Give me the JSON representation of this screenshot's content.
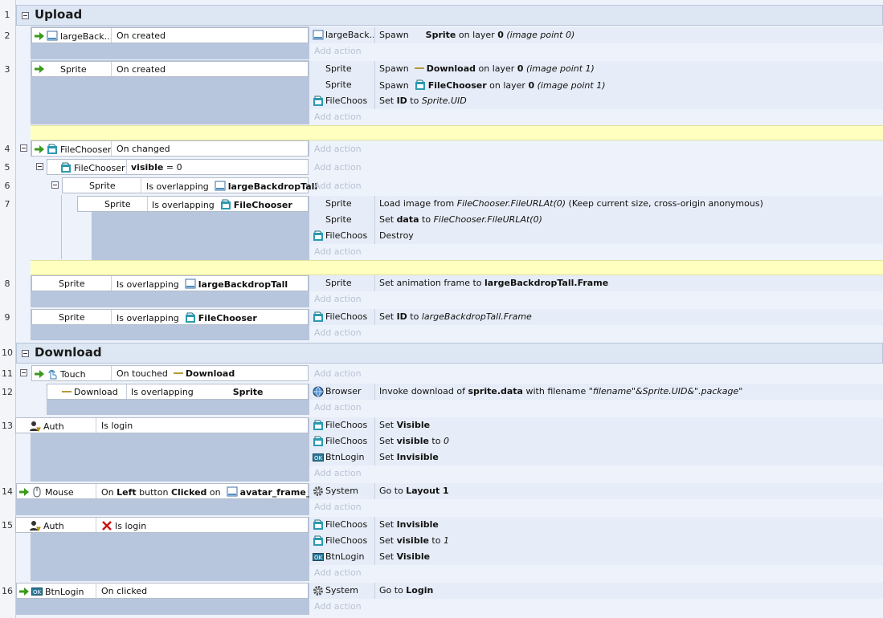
{
  "groups": {
    "upload": {
      "title": "Upload",
      "line": "1"
    },
    "download": {
      "title": "Download",
      "line": "10"
    }
  },
  "common": {
    "add_action": "Add action"
  },
  "events": {
    "e2": {
      "line": "2",
      "obj": "largeBack...",
      "cond": "On created",
      "a1": {
        "obj": "largeBack...",
        "verb": "Spawn",
        "b1": "Sprite",
        "t1": " on layer ",
        "b2": "0",
        "i1": " (image point 0)"
      }
    },
    "e3": {
      "line": "3",
      "obj": "Sprite",
      "cond": "On created",
      "a1": {
        "obj": "Sprite",
        "verb": "Spawn",
        "b1": "Download",
        "t1": " on layer ",
        "b2": "0",
        "i1": " (image point 1)"
      },
      "a2": {
        "obj": "Sprite",
        "verb": "Spawn",
        "b1": "FileChooser",
        "t1": " on layer ",
        "b2": "0",
        "i1": " (image point 1)"
      },
      "a3": {
        "obj": "FileChoos",
        "t1": "Set ",
        "b1": "ID",
        "t2": " to ",
        "i1": "Sprite.UID"
      }
    },
    "e4": {
      "line": "4",
      "obj": "FileChooser",
      "cond": "On changed"
    },
    "e5": {
      "line": "5",
      "obj": "FileChooser",
      "cond_b": "visible",
      "cond_t": " = 0"
    },
    "e6": {
      "line": "6",
      "obj": "Sprite",
      "cond": "Is overlapping",
      "target": "largeBackdropTall"
    },
    "e7": {
      "line": "7",
      "obj": "Sprite",
      "cond": "Is overlapping",
      "target": "FileChooser",
      "a1": {
        "obj": "Sprite",
        "t1": "Load image from ",
        "i1": "FileChooser.FileURLAt(0)",
        "t2": "  (Keep current size, cross-origin anonymous)"
      },
      "a2": {
        "obj": "Sprite",
        "t1": "Set ",
        "b1": "data",
        "t2": " to ",
        "i1": "FileChooser.FileURLAt(0)"
      },
      "a3": {
        "obj": "FileChoos",
        "t1": "Destroy"
      }
    },
    "e8": {
      "line": "8",
      "obj": "Sprite",
      "cond": "Is overlapping",
      "target": "largeBackdropTall",
      "a1": {
        "obj": "Sprite",
        "t1": "Set animation frame to ",
        "b1": "largeBackdropTall.Frame"
      }
    },
    "e9": {
      "line": "9",
      "obj": "Sprite",
      "cond": "Is overlapping",
      "target": "FileChooser",
      "a1": {
        "obj": "FileChoos",
        "t1": "Set ",
        "b1": "ID",
        "t2": " to ",
        "i1": "largeBackdropTall.Frame"
      }
    },
    "e11": {
      "line": "11",
      "obj": "Touch",
      "cond": "On touched",
      "target": "Download"
    },
    "e12": {
      "line": "12",
      "obj": "Download",
      "cond": "Is overlapping",
      "target": "Sprite",
      "a1": {
        "obj": "Browser",
        "t1": "Invoke download of ",
        "b1": "sprite.data",
        "t2": " with filename ",
        "i1": "\"filename\"&Sprite.UID&\".package\""
      }
    },
    "e13": {
      "line": "13",
      "obj": "Auth",
      "cond": "Is login",
      "a1": {
        "obj": "FileChoos",
        "t1": "Set ",
        "b1": "Visible"
      },
      "a2": {
        "obj": "FileChoos",
        "t1": "Set ",
        "b1": "visible",
        "t2": " to ",
        "i1": "0"
      },
      "a3": {
        "obj": "BtnLogin",
        "t1": "Set ",
        "b1": "Invisible"
      }
    },
    "e14": {
      "line": "14",
      "obj": "Mouse",
      "c1": "On ",
      "cb1": "Left",
      "c2": " button ",
      "cb2": "Clicked",
      "c3": " on ",
      "target": "avatar_frame_sm",
      "a1": {
        "obj": "System",
        "t1": "Go to ",
        "b1": "Layout 1"
      }
    },
    "e15": {
      "line": "15",
      "obj": "Auth",
      "cond": "Is login",
      "a1": {
        "obj": "FileChoos",
        "t1": "Set ",
        "b1": "Invisible"
      },
      "a2": {
        "obj": "FileChoos",
        "t1": "Set ",
        "b1": "visible",
        "t2": " to ",
        "i1": "1"
      },
      "a3": {
        "obj": "BtnLogin",
        "t1": "Set ",
        "b1": "Visible"
      }
    },
    "e16": {
      "line": "16",
      "obj": "BtnLogin",
      "cond": "On clicked",
      "a1": {
        "obj": "System",
        "t1": "Go to ",
        "b1": "Login"
      }
    }
  },
  "colors": {
    "group_bg": "#dde6f3",
    "condition_bg": "#b7c6dc",
    "action_bg": "#e7edf8",
    "comment_bg": "#ffffc0",
    "add_action_text": "#b8c3d4"
  },
  "icons": [
    "trigger-arrow-icon",
    "sprite-icon",
    "file-chooser-icon",
    "touch-icon",
    "mouse-icon",
    "auth-icon",
    "browser-icon",
    "system-gear-icon",
    "button-icon",
    "invert-x-icon",
    "collapse-icon"
  ]
}
